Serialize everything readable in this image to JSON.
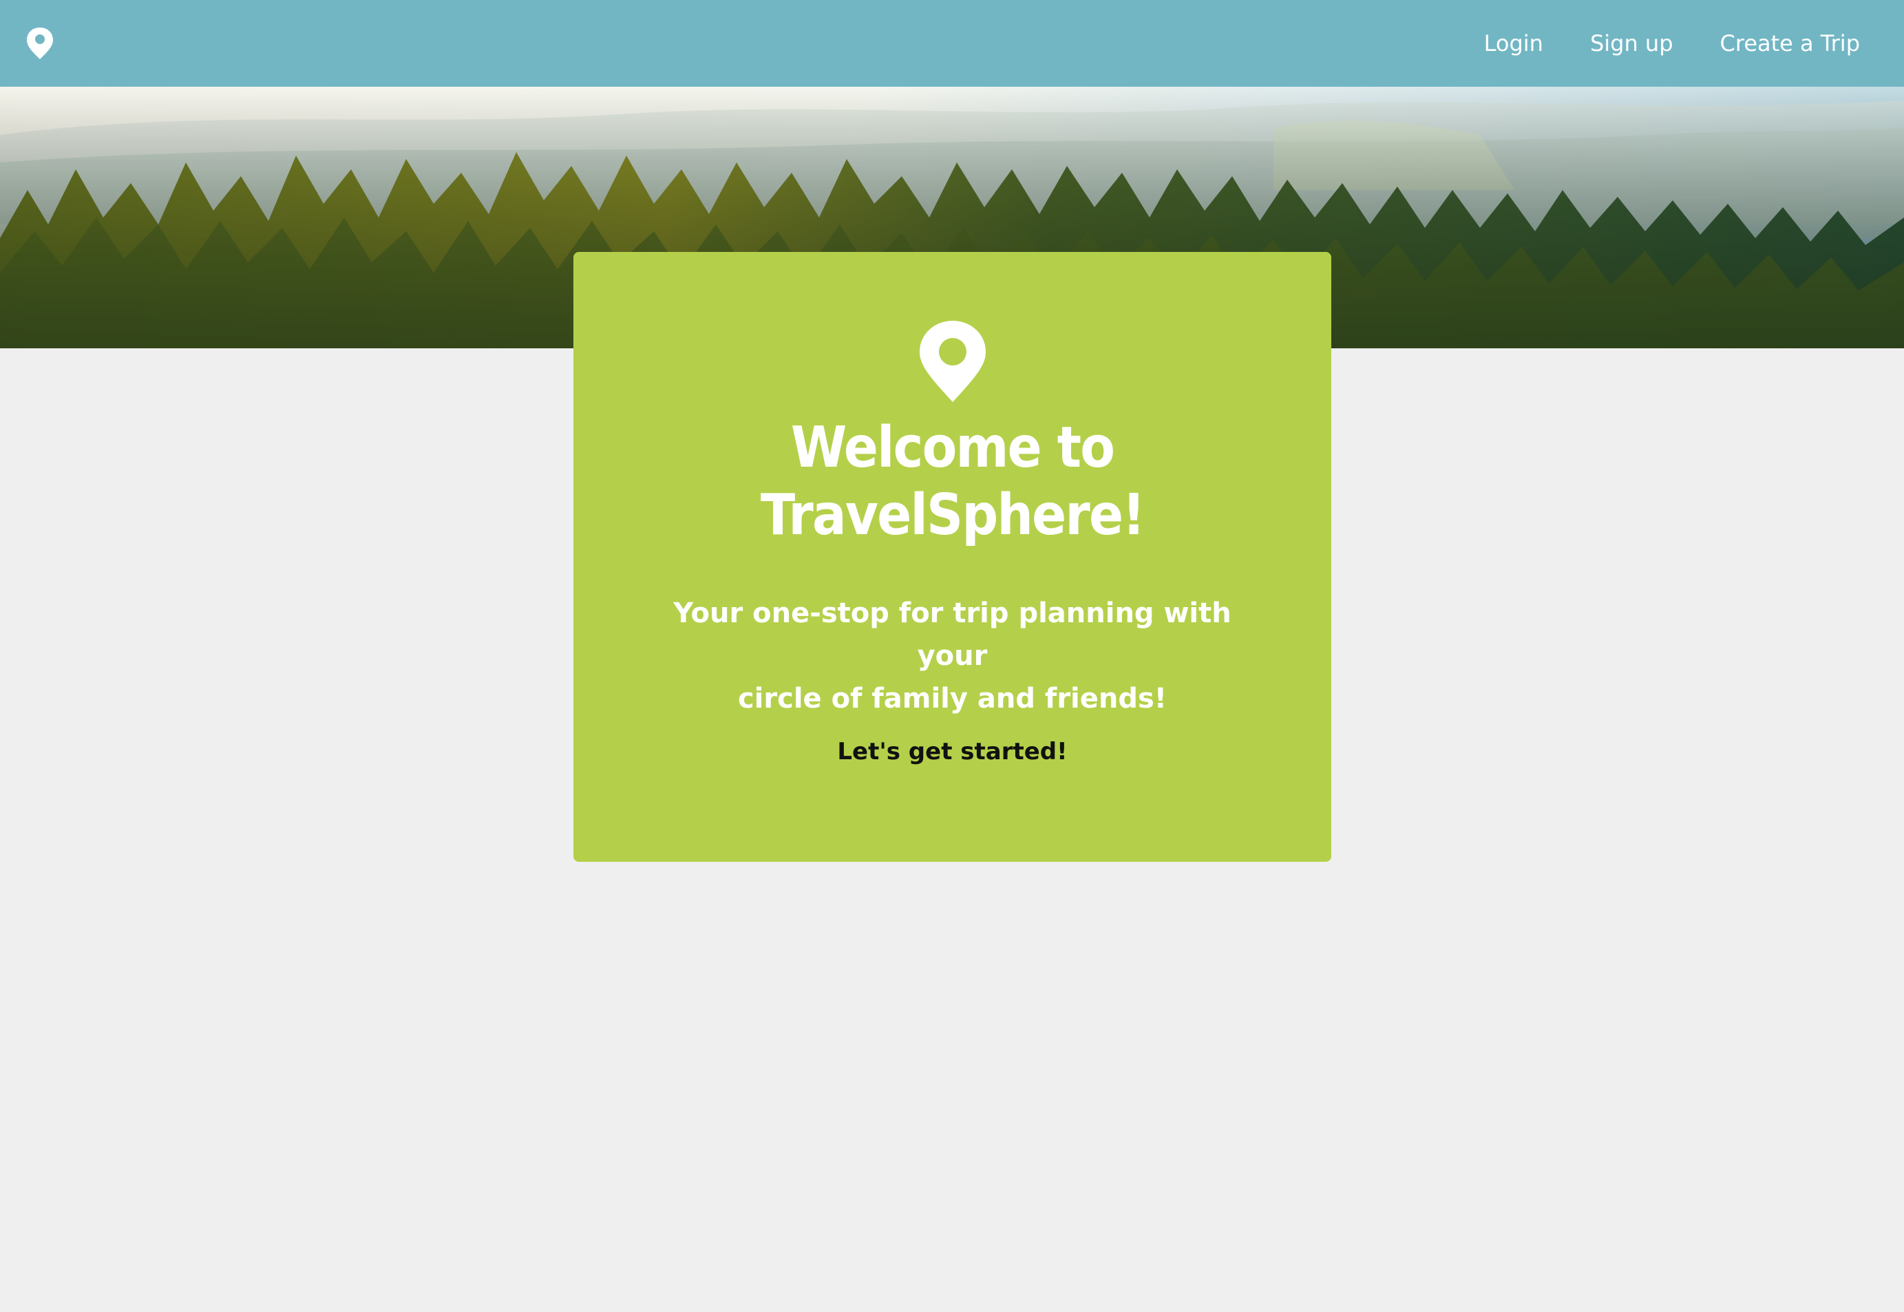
{
  "navbar": {
    "logo_icon": "map-pin-icon",
    "links": [
      {
        "label": "Login"
      },
      {
        "label": "Sign up"
      },
      {
        "label": "Create a Trip"
      }
    ],
    "background": "#72b6c4"
  },
  "hero": {
    "image": "pine-forest-landscape"
  },
  "card": {
    "icon": "map-pin-icon",
    "title_line1": "Welcome to",
    "title_line2": "TravelSphere!",
    "subtitle_line1": "Your one-stop for trip planning with your",
    "subtitle_line2": "circle of family and friends!",
    "cta_label": "Let's get started!",
    "background": "#b4d04a"
  },
  "colors": {
    "page_background": "#efefef",
    "text_light": "#ffffff",
    "text_dark": "#111111"
  }
}
